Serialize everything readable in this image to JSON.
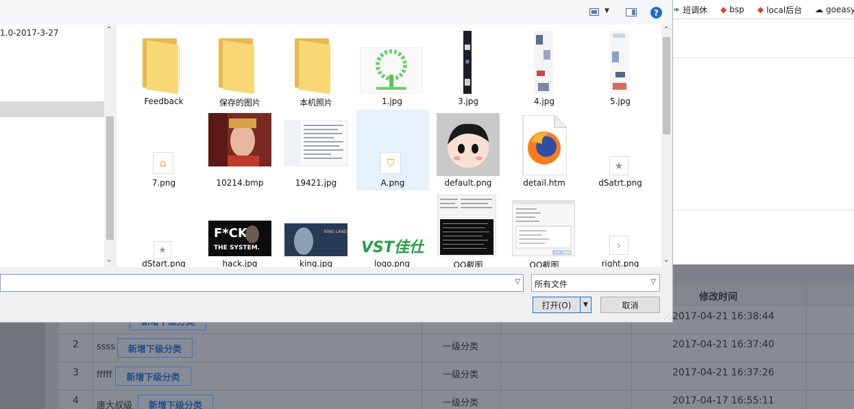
{
  "bookmarks": [
    {
      "icon": "leaf-icon",
      "label": "班调休",
      "color": "#2e8b3a"
    },
    {
      "icon": "diamond-icon",
      "label": "bsp",
      "color": "#d9432a"
    },
    {
      "icon": "diamond-icon",
      "label": "local后台",
      "color": "#d9432a"
    },
    {
      "icon": "cloud-icon",
      "label": "goeasy"
    }
  ],
  "dialog": {
    "help_label": "?",
    "nav_visible_text": "1.0-2017-3-27",
    "files": [
      {
        "name": "Feedback",
        "kind": "folder"
      },
      {
        "name": "保存的图片",
        "kind": "folder"
      },
      {
        "name": "本机照片",
        "kind": "folder"
      },
      {
        "name": "1.jpg",
        "kind": "image-green-tree"
      },
      {
        "name": "3.jpg",
        "kind": "image-tall-dark"
      },
      {
        "name": "4.jpg",
        "kind": "image-tall-light"
      },
      {
        "name": "5.jpg",
        "kind": "image-tall-light"
      },
      {
        "name": "7.png",
        "kind": "png-bag-icon"
      },
      {
        "name": "10214.bmp",
        "kind": "image-portrait"
      },
      {
        "name": "19421.jpg",
        "kind": "image-screenshot"
      },
      {
        "name": "A.png",
        "kind": "png-badge-icon",
        "selected": true
      },
      {
        "name": "default.png",
        "kind": "image-avatar"
      },
      {
        "name": "detail.htm",
        "kind": "firefox-document"
      },
      {
        "name": "dSatrt.png",
        "kind": "png-star-icon"
      },
      {
        "name": "dStart.png",
        "kind": "png-star-icon"
      },
      {
        "name": "hack.jpg",
        "kind": "image-text-poster",
        "poster_lines": [
          "F*CK",
          "THE SYSTEM."
        ]
      },
      {
        "name": "king.jpg",
        "kind": "image-game",
        "poster_lines": [
          "KING LAND"
        ]
      },
      {
        "name": "logo.png",
        "kind": "image-logo",
        "poster_lines": [
          "VST佳仕"
        ]
      },
      {
        "name": "QQ截图",
        "kind": "image-terminal"
      },
      {
        "name": "QQ截图",
        "kind": "image-settings"
      },
      {
        "name": "right.png",
        "kind": "png-arrow-icon"
      }
    ],
    "filename_value": "",
    "filetype_selected": "所有文件",
    "open_label": "打开(O)",
    "cancel_label": "取消"
  },
  "table": {
    "header_modified": "修改时间",
    "add_child_label": "新增下级分类",
    "rows": [
      {
        "index": "",
        "name": "",
        "level": "",
        "modified": "2017-04-21 16:38:44"
      },
      {
        "index": "2",
        "name": "ssss",
        "level": "一级分类",
        "modified": "2017-04-21 16:37:40"
      },
      {
        "index": "3",
        "name": "fffff",
        "level": "一级分类",
        "modified": "2017-04-21 16:37:26"
      },
      {
        "index": "4",
        "name": "唐大叔级",
        "level": "一级分类",
        "modified": "2017-04-17 16:55:11"
      }
    ]
  }
}
